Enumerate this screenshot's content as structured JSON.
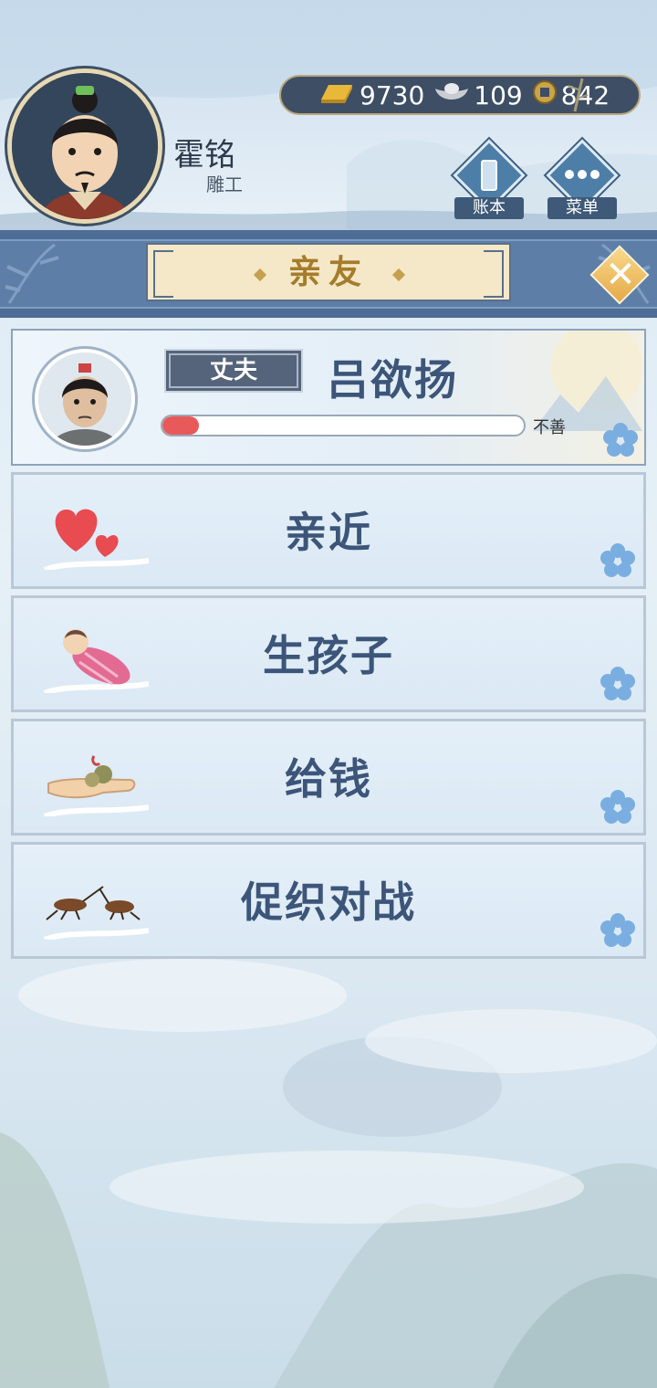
{
  "player": {
    "name": "霍铭",
    "occupation": "雕工"
  },
  "currency": {
    "gold": "9730",
    "silver": "109",
    "coins": "842"
  },
  "hud": {
    "ledger_label": "账本",
    "menu_label": "菜单"
  },
  "panel": {
    "title": "亲友"
  },
  "spouse": {
    "relation": "丈夫",
    "name": "吕欲扬",
    "affinity_label": "不善",
    "affinity_fraction": 0.1
  },
  "actions": [
    {
      "label": "亲近",
      "icon": "hearts-icon"
    },
    {
      "label": "生孩子",
      "icon": "baby-icon"
    },
    {
      "label": "给钱",
      "icon": "money-hand-icon"
    },
    {
      "label": "促织对战",
      "icon": "cricket-icon"
    }
  ],
  "colors": {
    "accent": "#3c5579",
    "banner": "#5d7ea6",
    "affinity_bar": "#e85a5a",
    "gold_button": "#f0c262"
  }
}
